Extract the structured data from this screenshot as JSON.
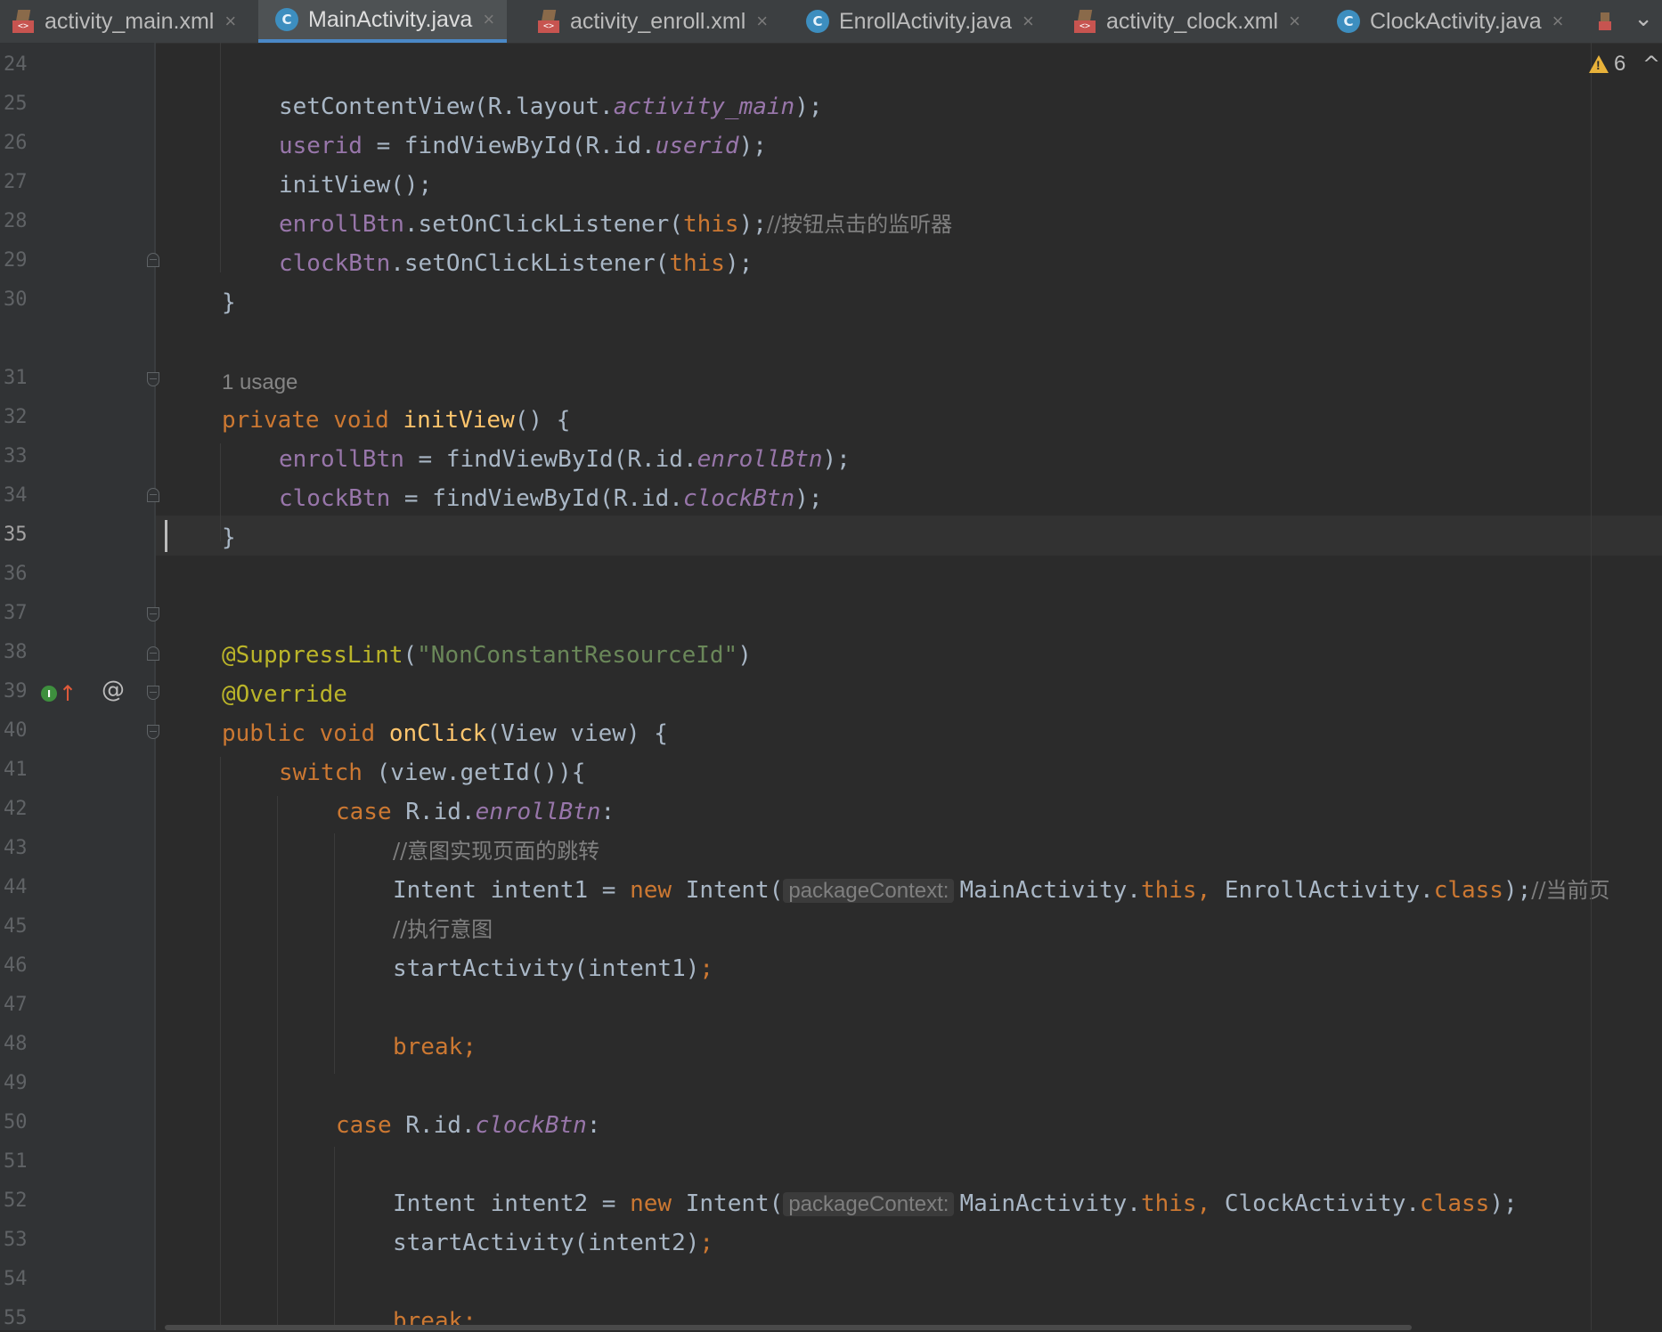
{
  "tabs": [
    {
      "label": "activity_main.xml",
      "icon": "xml-layout-icon",
      "active": false
    },
    {
      "label": "MainActivity.java",
      "icon": "java-class-icon",
      "active": true
    },
    {
      "label": "activity_enroll.xml",
      "icon": "xml-layout-icon",
      "active": false
    },
    {
      "label": "EnrollActivity.java",
      "icon": "java-class-icon",
      "active": false
    },
    {
      "label": "activity_clock.xml",
      "icon": "xml-layout-icon",
      "active": false
    },
    {
      "label": "ClockActivity.java",
      "icon": "java-class-icon",
      "active": false
    }
  ],
  "tab_close_glyph": "×",
  "tabs_more_glyph": "⌄",
  "class_icon_letter": "C",
  "xml_badge_text": "<>",
  "inspections": {
    "warning_count": "6",
    "icon": "warning-icon",
    "nav_glyph": "^"
  },
  "gutter": {
    "lines": [
      "24",
      "25",
      "26",
      "27",
      "28",
      "29",
      "30",
      "31",
      "32",
      "33",
      "34",
      "35",
      "36",
      "37",
      "38",
      "39",
      "40",
      "41",
      "42",
      "43",
      "44",
      "45",
      "46",
      "47",
      "48",
      "49",
      "50",
      "51",
      "52",
      "53",
      "54",
      "55"
    ],
    "current_line": "35",
    "implements_marker": "I",
    "implements_arrow": "↑",
    "at_marker": "@"
  },
  "code": {
    "usage_hint": "1 usage",
    "param_hint": "packageContext:",
    "l24": {
      "a": "setContentView(R.layout.",
      "b": "activity_main",
      "c": ");"
    },
    "l25": {
      "a": "userid",
      "b": " = findViewById(R.id.",
      "c": "userid",
      "d": ");"
    },
    "l26": {
      "a": "initView();"
    },
    "l27": {
      "a": "enrollBtn",
      "b": ".setOnClickListener(",
      "c": "this",
      "d": ");",
      "e": "//按钮点击的监听器"
    },
    "l28": {
      "a": "clockBtn",
      "b": ".setOnClickListener(",
      "c": "this",
      "d": ");"
    },
    "l29": {
      "a": "}"
    },
    "l31": {
      "a": "private void ",
      "b": "initView",
      "c": "() {"
    },
    "l32": {
      "a": "enrollBtn",
      "b": " = findViewById(R.id.",
      "c": "enrollBtn",
      "d": ");"
    },
    "l33": {
      "a": "clockBtn",
      "b": " = findViewById(R.id.",
      "c": "clockBtn",
      "d": ");"
    },
    "l34": {
      "a": "}"
    },
    "l37": {
      "a": "@SuppressLint",
      "b": "(",
      "c": "\"NonConstantResourceId\"",
      "d": ")"
    },
    "l38": {
      "a": "@Override"
    },
    "l39": {
      "a": "public void ",
      "b": "onClick",
      "c": "(View view) {"
    },
    "l40": {
      "a": "switch",
      "b": " (view.getId()){"
    },
    "l41": {
      "a": "case ",
      "b": "R.id.",
      "c": "enrollBtn",
      "d": ":"
    },
    "l42": {
      "a": "//意图实现页面的跳转"
    },
    "l43": {
      "a": "Intent intent1 = ",
      "b": "new",
      "c": " Intent(",
      "d": "MainActivity.",
      "e": "this",
      "f": ", ",
      "g": "EnrollActivity.",
      "h": "class",
      "i": ");",
      "j": "//当前页"
    },
    "l44": {
      "a": "//执行意图"
    },
    "l45": {
      "a": "startActivity(intent1)",
      "b": ";"
    },
    "l47": {
      "a": "break;"
    },
    "l49": {
      "a": "case ",
      "b": "R.id.",
      "c": "clockBtn",
      "d": ":"
    },
    "l51": {
      "a": "Intent intent2 = ",
      "b": "new",
      "c": " Intent(",
      "d": "MainActivity.",
      "e": "this",
      "f": ", ",
      "g": "ClockActivity.",
      "h": "class",
      "i": ");"
    },
    "l52": {
      "a": "startActivity(intent2)",
      "b": ";"
    },
    "l54": {
      "a": "break;"
    }
  }
}
